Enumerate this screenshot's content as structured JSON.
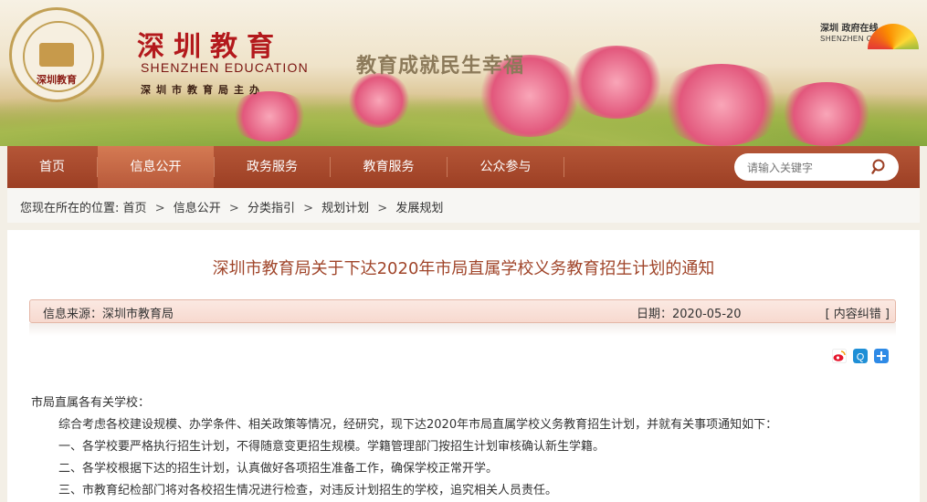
{
  "header": {
    "seal_text": "深圳教育",
    "brand_cn": "深圳教育",
    "brand_en": "SHENZHEN EDUCATION",
    "brand_sub": "深圳市教育局主办",
    "slogan": "教育成就民生幸福",
    "city_logo_cn": "深圳 政府在线",
    "city_logo_en": "SHENZHEN CHINA"
  },
  "nav": {
    "items": [
      {
        "label": "首页"
      },
      {
        "label": "信息公开"
      },
      {
        "label": "政务服务"
      },
      {
        "label": "教育服务"
      },
      {
        "label": "公众参与"
      }
    ],
    "active": "信息公开",
    "search_placeholder": "请输入关键字"
  },
  "breadcrumb": {
    "prefix": "您现在所在的位置:",
    "items": [
      "首页",
      "信息公开",
      "分类指引",
      "规划计划",
      "发展规划"
    ],
    "separator": ">"
  },
  "article": {
    "title": "深圳市教育局关于下达2020年市局直属学校义务教育招生计划的通知",
    "source": "信息来源：深圳市教育局",
    "date": "日期：2020-05-20",
    "correction": "[ 内容纠错 ]",
    "share_icons": [
      "weibo-icon",
      "qzone-icon",
      "more-share-icon"
    ],
    "paragraphs": [
      "市局直属各有关学校：",
      "综合考虑各校建设规模、办学条件、相关政策等情况，经研究，现下达2020年市局直属学校义务教育招生计划，并就有关事项通知如下：",
      "一、各学校要严格执行招生计划，不得随意变更招生规模。学籍管理部门按招生计划审核确认新生学籍。",
      "二、各学校根据下达的招生计划，认真做好各项招生准备工作，确保学校正常开学。",
      "三、市教育纪检部门将对各校招生情况进行检查，对违反计划招生的学校，追究相关人员责任。"
    ]
  },
  "colors": {
    "nav_bg": "#9c3f24",
    "nav_active": "#c56a47",
    "title": "#a0452a",
    "brand_red": "#b3191c"
  }
}
